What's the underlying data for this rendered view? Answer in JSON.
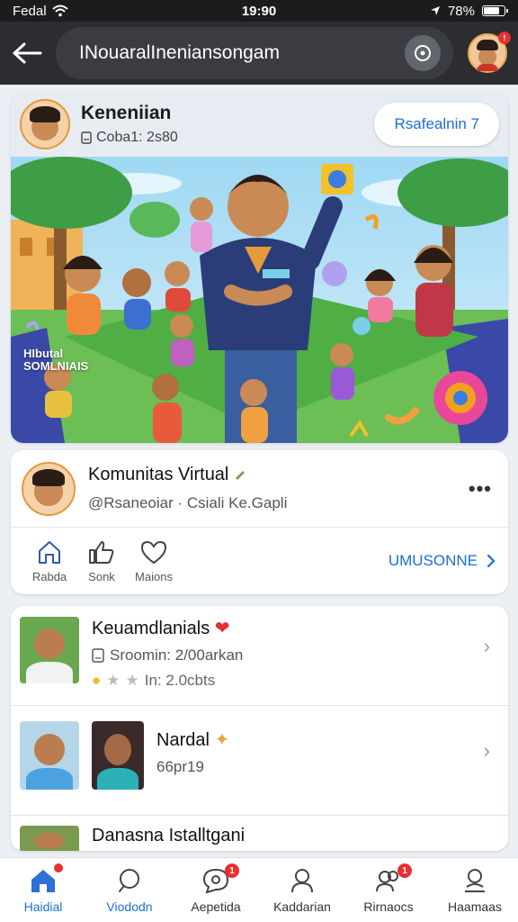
{
  "status_bar": {
    "carrier": "Fedal",
    "time": "19:90",
    "battery": "78%"
  },
  "header": {
    "title": "INouaralIneniansongam"
  },
  "feature": {
    "name": "Keneniian",
    "subtitle": "Coba1: 2s80",
    "follow_label": "Rsafealnin 7",
    "illustration_caption": "HIbutal SOMLNIAIS"
  },
  "post": {
    "title": "Komunitas Virtual",
    "handle": "@Rsaneoiar · Csiali Ke.Gapli",
    "actions": [
      {
        "label": "Rabda",
        "icon": "home-icon"
      },
      {
        "label": "Sonk",
        "icon": "thumbs-up-icon"
      },
      {
        "label": "Maions",
        "icon": "heart-icon"
      }
    ],
    "more_link": "UMUSONNE"
  },
  "list": {
    "items": [
      {
        "title": "Keuamdlanials",
        "line2": "Sroomin: 2/00arkan",
        "line3": "In: 2.0cbts"
      },
      {
        "title": "Nardal",
        "line2": "66pr19"
      },
      {
        "title": "Danasna Istalltgani"
      }
    ]
  },
  "bottom_nav": [
    {
      "label": "Haidial",
      "icon": "home-icon",
      "badge": ""
    },
    {
      "label": "Viododn",
      "icon": "search-icon",
      "badge": ""
    },
    {
      "label": "Aepetida",
      "icon": "chat-icon",
      "badge": "1"
    },
    {
      "label": "Kaddarian",
      "icon": "profile-icon",
      "badge": ""
    },
    {
      "label": "Rirnaocs",
      "icon": "group-icon",
      "badge": "1"
    },
    {
      "label": "Haamaas",
      "icon": "account-icon",
      "badge": ""
    }
  ],
  "colors": {
    "accent": "#1a6fd6",
    "badge": "#e8302f",
    "header_bg": "#2b2d31"
  }
}
